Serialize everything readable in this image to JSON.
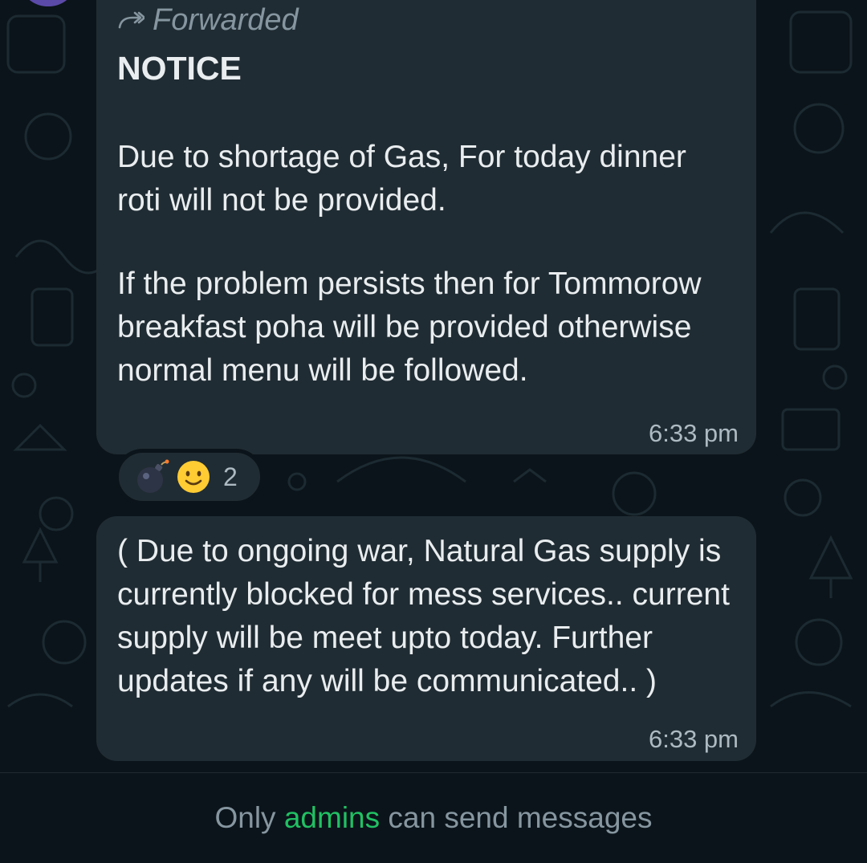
{
  "messages": [
    {
      "forwarded_label": "Forwarded",
      "title": "NOTICE",
      "paragraphs": [
        "Due to shortage of Gas, For today dinner roti will not be provided.",
        "If the problem persists then for Tommorow breakfast poha will be provided otherwise normal menu will be followed."
      ],
      "time": "6:33 pm",
      "reactions": {
        "emojis": [
          "bomb-emoji",
          "smiling-face-emoji"
        ],
        "count": "2"
      }
    },
    {
      "text": "( Due to ongoing war, Natural Gas supply is currently blocked for mess services.. current supply will be meet upto today. Further updates if any will be communicated.. )",
      "time": "6:33 pm"
    }
  ],
  "footer": {
    "prefix": "Only",
    "admins_label": "admins",
    "suffix": "can send messages"
  },
  "colors": {
    "background": "#0b141a",
    "bubble": "#202c33",
    "text": "#e9edef",
    "muted": "#8696a0",
    "accent": "#21c063",
    "avatar": "#5b4aa8"
  }
}
